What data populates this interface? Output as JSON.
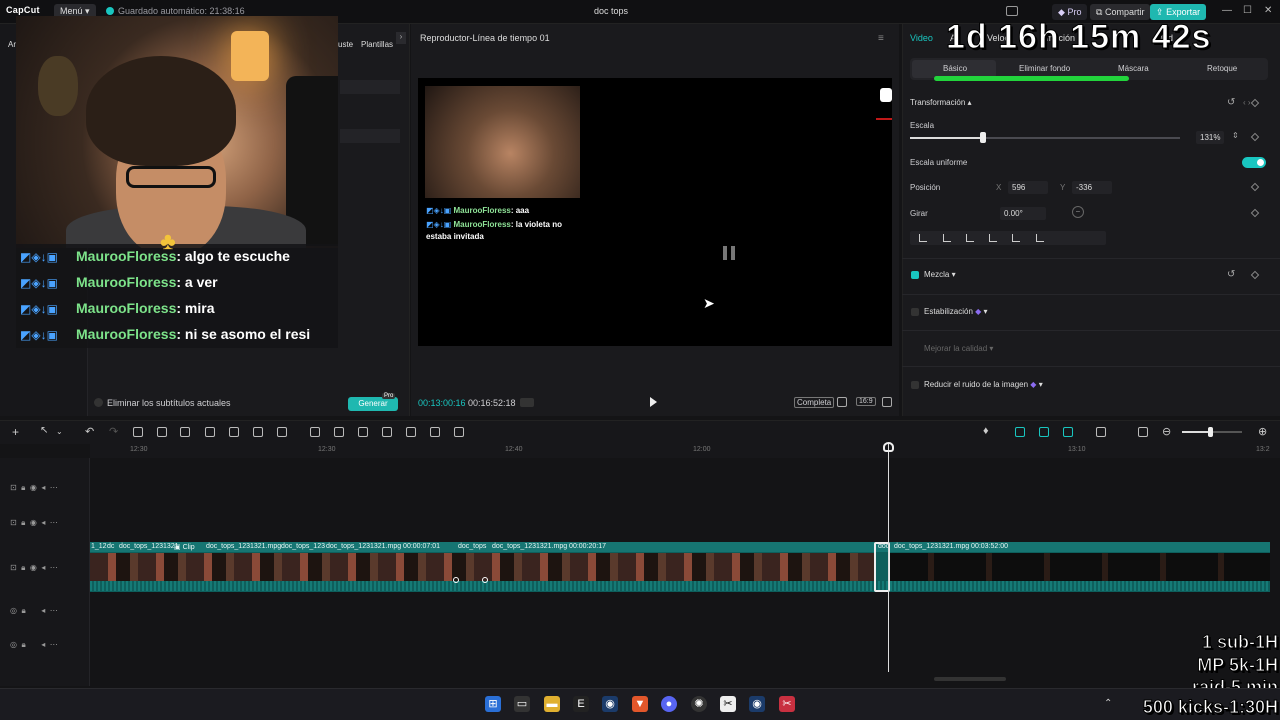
{
  "titlebar": {
    "logo": "CapCut",
    "menu_label": "Menú",
    "autosave": "Guardado automático: 21:38:16",
    "doc_title": "doc tops",
    "pro_label": "Pro",
    "share_label": "Compartir",
    "export_label": "Exportar"
  },
  "left_panel": {
    "tab_adjust": "uste",
    "tab_templates": "Plantillas",
    "tab_ar": "Ar",
    "remove_subs_label": "Eliminar los subtítulos actuales",
    "generate_label": "Generar",
    "pro_badge": "Pro"
  },
  "overlay_chat": [
    {
      "user": "MaurooFloress",
      "msg": ": algo te escuche"
    },
    {
      "user": "MaurooFloress",
      "msg": ": a ver"
    },
    {
      "user": "MaurooFloress",
      "msg": ": mira"
    },
    {
      "user": "MaurooFloress",
      "msg": ": ni se asomo el resi"
    }
  ],
  "player": {
    "title": "Reproductor-Línea de tiempo 01",
    "inner_chat": [
      {
        "user": "MaurooFloress",
        "msg": ": aaa"
      },
      {
        "user": "MaurooFloress",
        "msg": ": la violeta no"
      },
      {
        "user": "",
        "msg": "estaba invitada"
      }
    ],
    "current_time": "00:13:00:16",
    "total_time": "00:16:52:18",
    "fit_label": "Completa",
    "ratio_label": "16:9"
  },
  "properties": {
    "tabs": [
      "Video",
      "Au",
      "Veloc",
      "mación",
      "dad"
    ],
    "subtabs": [
      "Básico",
      "Eliminar fondo",
      "Máscara",
      "Retoque"
    ],
    "transform_title": "Transformación",
    "scale_label": "Escala",
    "scale_value": "131%",
    "scale_fraction": 0.27,
    "uniform_label": "Escala uniforme",
    "position_label": "Posición",
    "pos_x_label": "X",
    "pos_x": "596",
    "pos_y_label": "Y",
    "pos_y": "-336",
    "rotate_label": "Girar",
    "rotate_value": "0.00°",
    "blend_label": "Mezcla",
    "stabilize_label": "Estabilización",
    "improve_quality_label": "Mejorar la calidad",
    "reduce_noise_label": "Reducir el ruido de la imagen"
  },
  "stream_overlay": {
    "timer": "1d 16h 15m 42s",
    "goals": [
      "1 sub-1H",
      "MP 5k-1H",
      "raid-5 min",
      "500 kicks-1:30H"
    ]
  },
  "timeline": {
    "ruler_ticks": [
      "12:30",
      "12:30",
      "12:40",
      "12:00",
      "13:10",
      "13:2"
    ],
    "clips": [
      {
        "label": "1_12"
      },
      {
        "label": "dc"
      },
      {
        "label": "doc_tops_1231321"
      },
      {
        "label": "Clip"
      },
      {
        "label": "doc_tops_1231321.mpg"
      },
      {
        "label": "doc_tops_123"
      },
      {
        "label": "doc_tops_1231321.mpg  00:00:07:01"
      },
      {
        "label": "doc_tops"
      },
      {
        "label": "doc_tops_1231321.mpg  00:00:20:17"
      },
      {
        "label": "doc"
      },
      {
        "label": "doc_tops_1231321.mpg  00:03:52:00"
      }
    ]
  },
  "taskbar": {
    "icons": [
      "windows-start",
      "terminal",
      "file-explorer",
      "epic-games",
      "steam",
      "brave",
      "discord",
      "chatgpt",
      "capcut",
      "steam-2",
      "snipping-tool"
    ]
  },
  "colors": {
    "accent": "#19c6c0",
    "export": "#1fb8b0",
    "chat_user": "#7de38a",
    "progress_green": "#22d43c",
    "clip_teal": "#0e5f5c"
  }
}
